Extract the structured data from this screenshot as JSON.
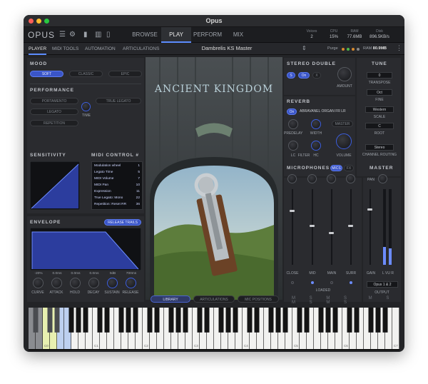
{
  "window": {
    "title": "Opus"
  },
  "nav": {
    "logo": "OPUS",
    "tabs": [
      {
        "label": "BROWSE"
      },
      {
        "label": "PLAY",
        "active": true
      },
      {
        "label": "PERFORM"
      },
      {
        "label": "MIX"
      }
    ],
    "stats": [
      {
        "label": "Voices",
        "value": "2"
      },
      {
        "label": "CPU",
        "value": "15%"
      },
      {
        "label": "RAM",
        "value": "77.6MB"
      },
      {
        "label": "Disk",
        "value": "896.5KB/s"
      }
    ]
  },
  "subnav": {
    "tabs": [
      {
        "label": "PLAYER",
        "active": true
      },
      {
        "label": "MIDI TOOLS"
      },
      {
        "label": "AUTOMATION"
      },
      {
        "label": "ARTICULATIONS"
      }
    ],
    "instrument": "Dambrelis KS Master",
    "purge_label": "Purge",
    "ram_label": "RAM",
    "ram_value": "80.9MB"
  },
  "mood": {
    "header": "MOOD",
    "options": [
      {
        "label": "SOFT",
        "active": true
      },
      {
        "label": "CLASSIC"
      },
      {
        "label": "EPIC"
      }
    ]
  },
  "performance": {
    "header": "PERFORMANCE",
    "buttons": [
      "PORTAMENTO",
      "TRUE LEGATO",
      "LEGATO",
      "REPETITION"
    ],
    "time_label": "TIME"
  },
  "sensitivity": {
    "header": "SENSITIVITY"
  },
  "midi_control": {
    "header": "MIDI CONTROL #",
    "rows": [
      {
        "name": "Modulation wheel",
        "value": "1"
      },
      {
        "name": "Legato Time",
        "value": "5"
      },
      {
        "name": "MIDI Volume",
        "value": "7"
      },
      {
        "name": "MIDI Pan",
        "value": "10"
      },
      {
        "name": "Expression",
        "value": "11"
      },
      {
        "name": "True Legato: Mono",
        "value": "22"
      },
      {
        "name": "Repetition: Reset RR",
        "value": "36"
      }
    ]
  },
  "envelope": {
    "header": "ENVELOPE",
    "mode": "RELEASE TRAILS",
    "values": [
      "-20%",
      "0.0ms",
      "0.0ms",
      "0.0ms",
      "0dB",
      "700ms"
    ],
    "labels": [
      "CURVE",
      "ATTACK",
      "HOLD",
      "DECAY",
      "SUSTAIN",
      "RELEASE"
    ]
  },
  "artwork": {
    "title": "ANCIENT KINGDOM"
  },
  "bottom_tabs": [
    {
      "label": "LIBRARY",
      "active": true
    },
    {
      "label": "ARTICULATIONS"
    },
    {
      "label": "MIC POSITIONS"
    }
  ],
  "stereo_double": {
    "header": "STEREO DOUBLE",
    "toggles": [
      "S",
      "On",
      "X"
    ],
    "amount_label": "AMOUNT"
  },
  "reverb": {
    "header": "REVERB",
    "on_label": "On",
    "preset": "ABRAVANEL ORGAN FR LR",
    "master_label": "MASTER",
    "knobs": [
      "PREDELAY",
      "WIDTH",
      "LC",
      "FILTER",
      "HC",
      "VOLUME"
    ]
  },
  "tune": {
    "header": "TUNE",
    "transpose_value": "0",
    "transpose_label": "TRANSPOSE",
    "fine_value": "Oct",
    "fine_label": "FINE",
    "scale_value": "Western",
    "scale_label": "SCALE",
    "root_value": "C",
    "root_label": "ROOT",
    "routing_value": "Stereo",
    "routing_label": "CHANNEL ROUTING"
  },
  "microphones": {
    "header": "MICROPHONES",
    "mode_tabs": [
      "MICS",
      "FX"
    ],
    "channels": [
      "CLOSE",
      "MID",
      "MAIN",
      "SURR"
    ],
    "loaded_label": "LOADED",
    "fader_levels": [
      0.72,
      0.52,
      0.42,
      0.52
    ]
  },
  "master": {
    "header": "MASTER",
    "pan_label": "PAN",
    "gain_label": "GAIN",
    "lvr_label": "L VU R",
    "output_value": "Opus 1 & 2",
    "output_label": "OUTPUT",
    "vu_levels": [
      0.24,
      0.22
    ]
  },
  "keyboard": {
    "octave_labels": [
      "C0",
      "C1",
      "C2",
      "C3",
      "C4",
      "C5",
      "C6",
      "C7"
    ]
  },
  "colors": {
    "accent": "#3a55c8",
    "window_bg": "#232427",
    "panel_bg": "#2a2b2f"
  }
}
